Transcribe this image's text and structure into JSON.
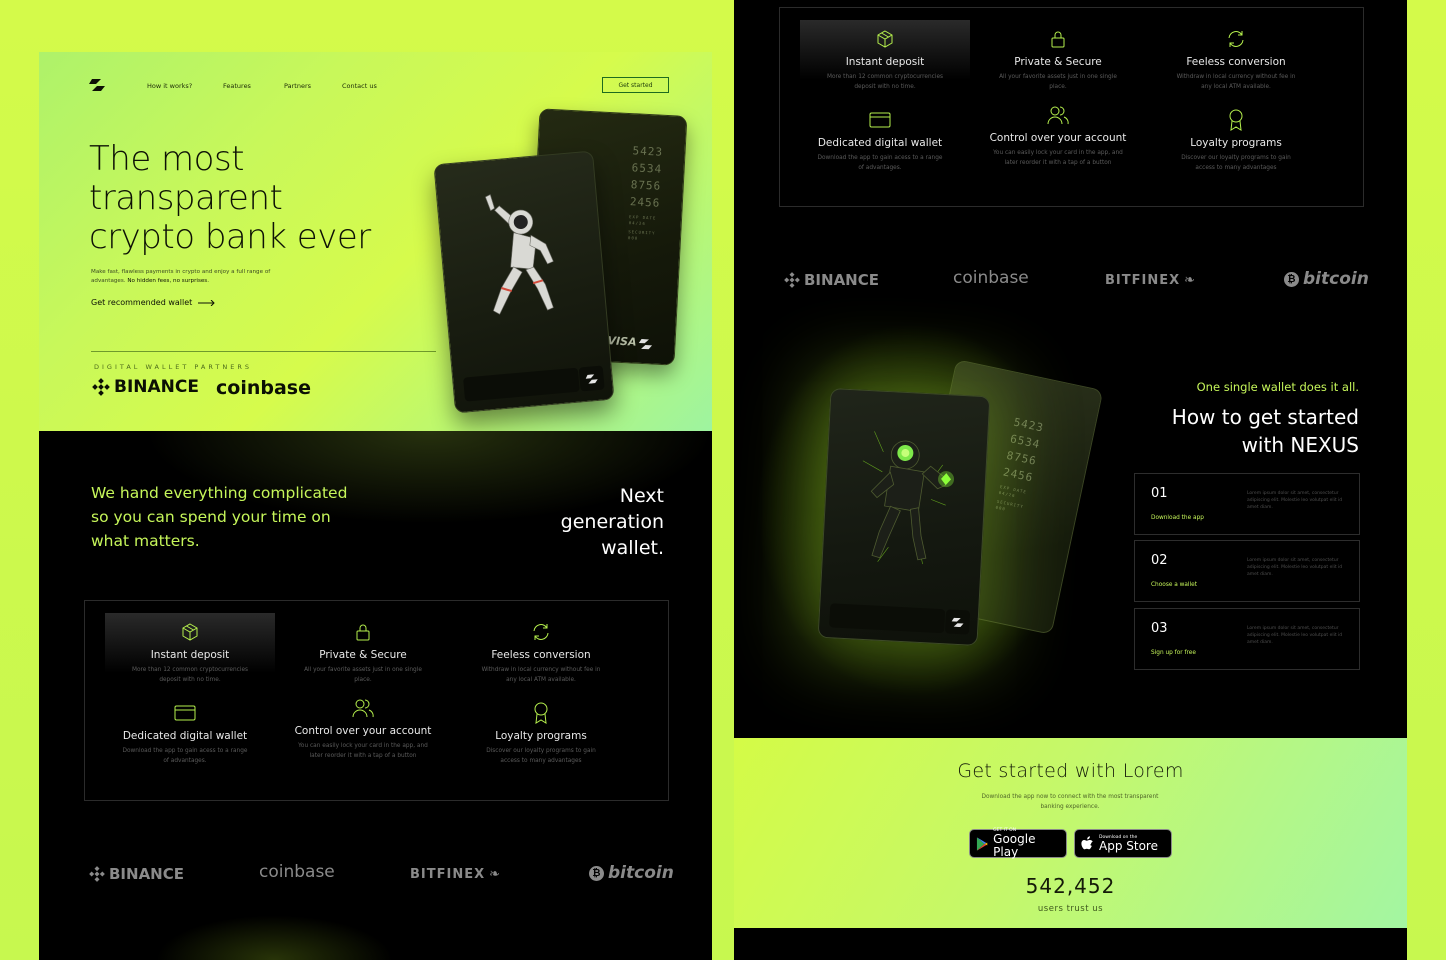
{
  "nav": {
    "links": [
      "How it works?",
      "Features",
      "Partners",
      "Contact us"
    ],
    "cta": "Get started"
  },
  "hero": {
    "title_lines": [
      "The most",
      "transparent",
      "crypto bank ever"
    ],
    "subtitle_1": "Make fast, flawless payments in crypto and enjoy a full range of advantages.",
    "subtitle_2": "No hidden fees, no surprises.",
    "cta": "Get recommended wallet",
    "partners_label": "DIGITAL WALLET PARTNERS",
    "partners": [
      "BINANCE",
      "coinbase"
    ]
  },
  "card": {
    "numbers": [
      "5423",
      "6534",
      "8756",
      "2456"
    ],
    "exp_label": "EXP DATE 04/26",
    "sec_label": "SECURITY 000",
    "brand": "VISA"
  },
  "section2": {
    "tagline": "We hand everything complicated so you can spend your time on what matters.",
    "next_gen": [
      "Next",
      "generation",
      "wallet."
    ]
  },
  "features": [
    {
      "title": "Instant deposit",
      "desc": "More than 12 common cryptocurrencies deposit with no time.",
      "icon": "cube-icon"
    },
    {
      "title": "Private & Secure",
      "desc": "All your favorite assets just in one single place.",
      "icon": "lock-icon"
    },
    {
      "title": "Feeless conversion",
      "desc": "Withdraw in local currency without fee in any local ATM available.",
      "icon": "refresh-icon"
    },
    {
      "title": "Dedicated digital wallet",
      "desc": "Download the app to gain acess to a range of advantages.",
      "icon": "card-icon"
    },
    {
      "title": "Control over your account",
      "desc": "You can easily lock your card in the app, and later reorder it with a tap of a button",
      "icon": "users-icon"
    },
    {
      "title": "Loyalty programs",
      "desc": "Discover our loyalty programs to gain access to many advantages",
      "icon": "badge-icon"
    }
  ],
  "partners_row": [
    "BINANCE",
    "coinbase",
    "BITFINEX",
    "bitcoin"
  ],
  "how": {
    "tag": "One single wallet does it all.",
    "title_lines": [
      "How to get started",
      "with NEXUS"
    ],
    "steps": [
      {
        "num": "01",
        "label": "Download the app",
        "desc": "Lorem ipsum dolor sit amet, consectetur adipiscing elit. Molestie leo volutpat elit id amet diam."
      },
      {
        "num": "02",
        "label": "Choose a wallet",
        "desc": "Lorem ipsum dolor sit amet, consectetur adipiscing elit. Molestie leo volutpat elit id amet diam."
      },
      {
        "num": "03",
        "label": "Sign up for free",
        "desc": "Lorem ipsum dolor sit amet, consectetur adipiscing elit. Molestie leo volutpat elit id amet diam."
      }
    ]
  },
  "cta_block": {
    "title": "Get started with Lorem",
    "sub": "Download the app now to connect with the most transparent banking experience.",
    "google_small": "GET IT ON",
    "google_big": "Google Play",
    "apple_small": "Download on the",
    "apple_big": "App Store",
    "count": "542,452",
    "count_label": "users trust us"
  },
  "colors": {
    "accent": "#c6f65a",
    "bg_lime": "#d4fa4a",
    "dark": "#000000"
  }
}
